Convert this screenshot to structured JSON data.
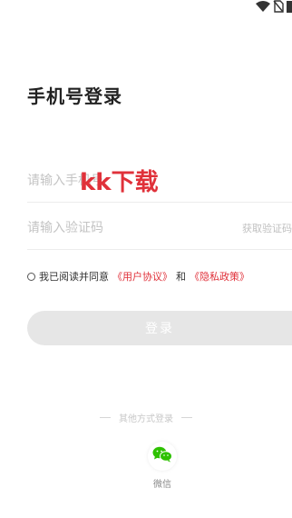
{
  "status_bar": {
    "icons": [
      "wifi-icon",
      "no-sim-icon",
      "battery-icon"
    ]
  },
  "page": {
    "title": "手机号登录"
  },
  "form": {
    "phone_placeholder": "请输入手机号",
    "code_placeholder": "请输入验证码",
    "get_code_label": "获取验证码"
  },
  "watermark": "kk下载",
  "agreement": {
    "prefix": "我已阅读并同意",
    "user_agreement": "《用户协议》",
    "and": "和",
    "privacy_policy": "《隐私政策》"
  },
  "login_button": "登录",
  "other_methods": {
    "title": "其他方式登录",
    "wechat_label": "微信"
  },
  "colors": {
    "accent": "#e0313a",
    "button_disabled": "#e6e6e6",
    "wechat_green": "#2dc100"
  }
}
